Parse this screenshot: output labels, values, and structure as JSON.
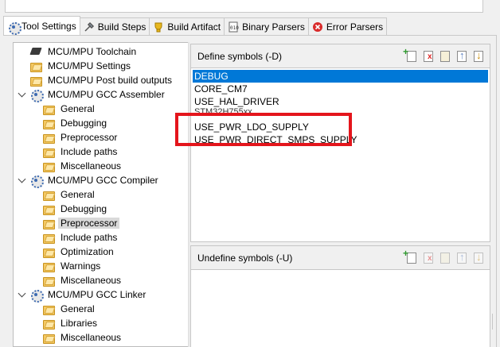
{
  "tabs": [
    {
      "label": "Tool Settings",
      "icon": "tool-settings-icon",
      "active": true
    },
    {
      "label": "Build Steps",
      "icon": "build-steps-icon",
      "active": false
    },
    {
      "label": "Build Artifact",
      "icon": "build-artifact-icon",
      "active": false
    },
    {
      "label": "Binary Parsers",
      "icon": "binary-parsers-icon",
      "active": false
    },
    {
      "label": "Error Parsers",
      "icon": "error-parsers-icon",
      "active": false
    }
  ],
  "tree": {
    "items": [
      {
        "label": "MCU/MPU Toolchain",
        "icon": "chip-icon"
      },
      {
        "label": "MCU/MPU Settings",
        "icon": "folder-icon"
      },
      {
        "label": "MCU/MPU Post build outputs",
        "icon": "folder-icon"
      },
      {
        "label": "MCU/MPU GCC Assembler",
        "icon": "gear-icon"
      },
      {
        "label": "General",
        "icon": "folder-icon"
      },
      {
        "label": "Debugging",
        "icon": "folder-icon"
      },
      {
        "label": "Preprocessor",
        "icon": "folder-icon"
      },
      {
        "label": "Include paths",
        "icon": "folder-icon"
      },
      {
        "label": "Miscellaneous",
        "icon": "folder-icon"
      },
      {
        "label": "MCU/MPU GCC Compiler",
        "icon": "gear-icon"
      },
      {
        "label": "General",
        "icon": "folder-icon"
      },
      {
        "label": "Debugging",
        "icon": "folder-icon"
      },
      {
        "label": "Preprocessor",
        "icon": "folder-icon",
        "selected": true
      },
      {
        "label": "Include paths",
        "icon": "folder-icon"
      },
      {
        "label": "Optimization",
        "icon": "folder-icon"
      },
      {
        "label": "Warnings",
        "icon": "folder-icon"
      },
      {
        "label": "Miscellaneous",
        "icon": "folder-icon"
      },
      {
        "label": "MCU/MPU GCC Linker",
        "icon": "gear-icon"
      },
      {
        "label": "General",
        "icon": "folder-icon"
      },
      {
        "label": "Libraries",
        "icon": "folder-icon"
      },
      {
        "label": "Miscellaneous",
        "icon": "folder-icon"
      }
    ]
  },
  "define": {
    "title": "Define symbols (-D)",
    "symbols": [
      "DEBUG",
      "CORE_CM7",
      "USE_HAL_DRIVER",
      "STM32H755xx",
      "USE_PWR_LDO_SUPPLY",
      "USE_PWR_DIRECT_SMPS_SUPPLY"
    ],
    "selected": "DEBUG"
  },
  "undefine": {
    "title": "Undefine symbols (-U)",
    "symbols": []
  },
  "colors": {
    "selection": "#0078d7",
    "highlight_box": "#e4151c"
  }
}
